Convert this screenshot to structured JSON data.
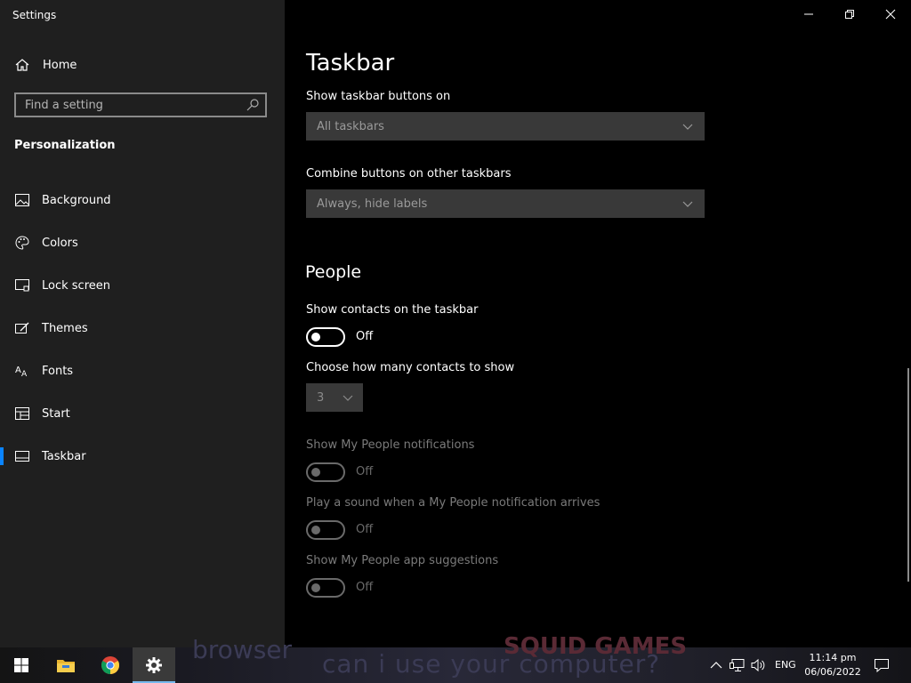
{
  "window": {
    "title": "Settings"
  },
  "sidebar": {
    "home_label": "Home",
    "search_placeholder": "Find a setting",
    "section": "Personalization",
    "items": [
      {
        "label": "Background",
        "icon": "image-icon"
      },
      {
        "label": "Colors",
        "icon": "palette-icon"
      },
      {
        "label": "Lock screen",
        "icon": "lock-screen-icon"
      },
      {
        "label": "Themes",
        "icon": "themes-icon"
      },
      {
        "label": "Fonts",
        "icon": "fonts-icon"
      },
      {
        "label": "Start",
        "icon": "start-icon"
      },
      {
        "label": "Taskbar",
        "icon": "taskbar-icon",
        "active": true
      }
    ]
  },
  "main": {
    "title": "Taskbar",
    "show_buttons_label": "Show taskbar buttons on",
    "show_buttons_value": "All taskbars",
    "combine_label": "Combine buttons on other taskbars",
    "combine_value": "Always, hide labels",
    "people_heading": "People",
    "show_contacts_label": "Show contacts on the taskbar",
    "show_contacts_state": "Off",
    "contacts_count_label": "Choose how many contacts to show",
    "contacts_count_value": "3",
    "notifications_label": "Show My People notifications",
    "notifications_state": "Off",
    "sound_label": "Play a sound when a My People notification arrives",
    "sound_state": "Off",
    "suggestions_label": "Show My People app suggestions",
    "suggestions_state": "Off"
  },
  "taskbar": {
    "wallpaper_text": [
      "browser",
      "can i use your computer?",
      "SQUID GAMES"
    ],
    "language": "ENG",
    "time": "11:14 pm",
    "date": "06/06/2022"
  },
  "colors": {
    "accent": "#0a84ff",
    "sidebar_bg": "#1f1f1f",
    "content_bg": "#000000"
  }
}
